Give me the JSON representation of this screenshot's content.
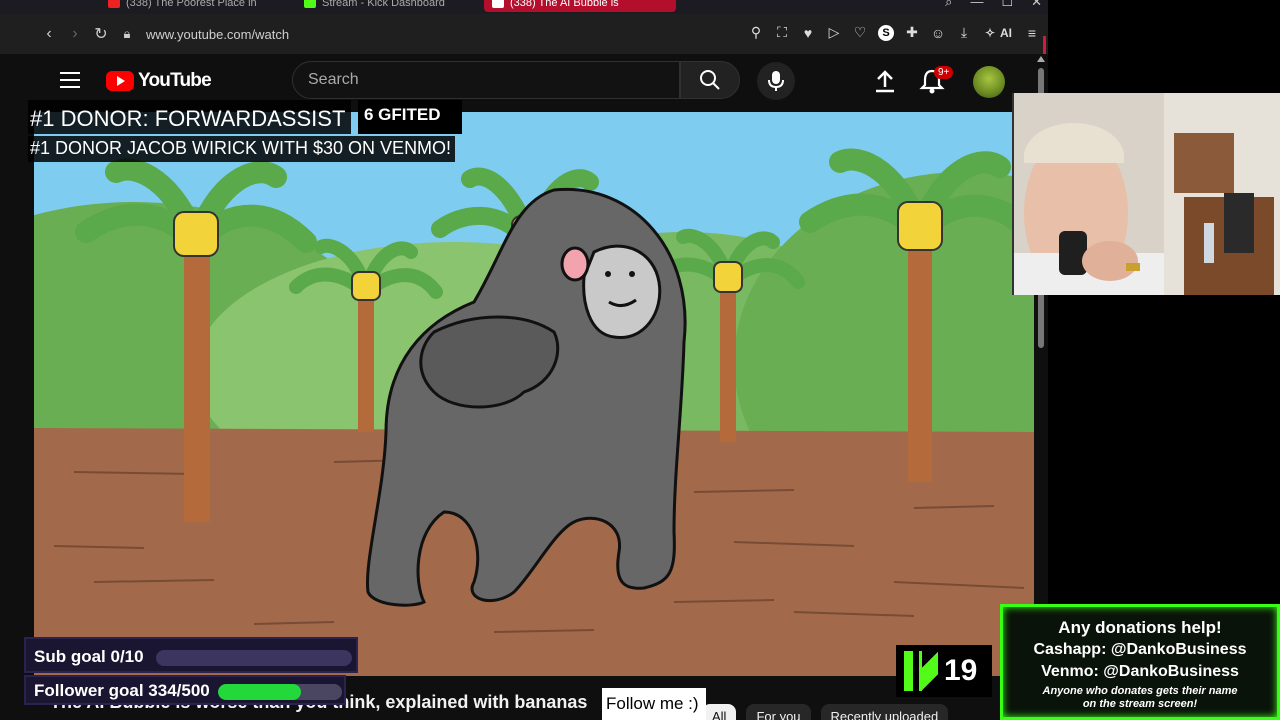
{
  "browser": {
    "tabs": [
      {
        "label": "(338) The Poorest Place in",
        "active": false
      },
      {
        "label": "Stream - Kick Dashboard",
        "active": false
      },
      {
        "label": "(338) The AI Bubble is",
        "active": true
      }
    ],
    "url": "www.youtube.com/watch",
    "ai_label": "AI"
  },
  "youtube": {
    "logo_text": "YouTube",
    "search_placeholder": "Search",
    "notification_count": "9+",
    "video_title": "The AI Bubble is worse than you think, explained with bananas",
    "chips": [
      {
        "label": "All",
        "active": true
      },
      {
        "label": "For you",
        "active": false
      },
      {
        "label": "Recently uploaded",
        "active": false
      }
    ]
  },
  "overlay": {
    "donor_line1": "#1 DONOR: FORWARDASSIST",
    "gifted": "6 GFITED",
    "donor_line2": "#1 DONOR JACOB WIRICK WITH $30 ON VENMO!",
    "sub_goal_label": "Sub goal 0/10",
    "sub_goal_progress": 0.0,
    "follower_goal_label": "Follower goal 334/500",
    "follower_goal_progress": 0.668,
    "kick_viewers": "19",
    "follow_me": "Follow me :)",
    "donate_line1": "Any donations help!",
    "donate_line2": "Cashapp: @DankoBusiness",
    "donate_line3": "Venmo: @DankoBusiness",
    "donate_small1": "Anyone who donates gets their name",
    "donate_small2": "on the stream screen!"
  },
  "colors": {
    "youtube_red": "#ff0000",
    "kick_green": "#53fc18",
    "donate_border": "#39ff14",
    "follower_bar": "#22d83a"
  }
}
